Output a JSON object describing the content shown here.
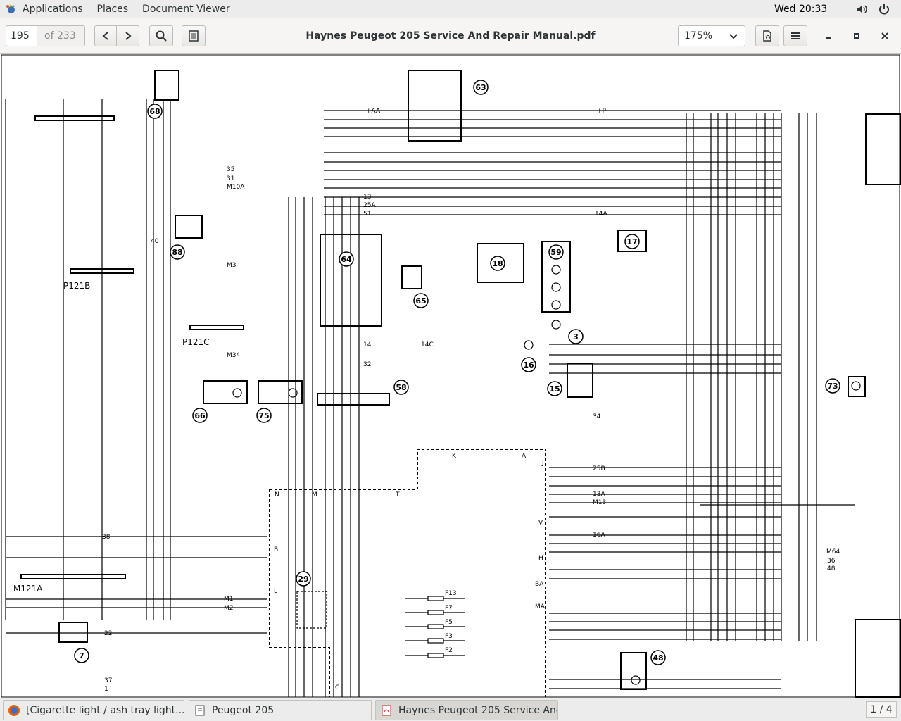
{
  "topbar": {
    "applications": "Applications",
    "places": "Places",
    "app_name": "Document Viewer",
    "clock": "Wed 20:33"
  },
  "toolbar": {
    "page_current": "195",
    "page_total": "of 233",
    "title": "Haynes Peugeot 205 Service And Repair Manual.pdf",
    "zoom": "175%"
  },
  "diagram": {
    "components": [
      "68",
      "63",
      "88",
      "64",
      "65",
      "18",
      "59",
      "17",
      "3",
      "16",
      "15",
      "73",
      "66",
      "75",
      "58",
      "29",
      "7",
      "48"
    ],
    "sockets": [
      "P121B",
      "P121C",
      "M121A"
    ],
    "wire_labels": [
      "+AA",
      "+P",
      "35",
      "31",
      "M10A",
      "13",
      "25A",
      "51",
      "14A",
      "M3",
      "14",
      "M34",
      "32",
      "14C",
      "25B",
      "13A",
      "M13",
      "16A",
      "34",
      "38",
      "M1",
      "M2",
      "22",
      "37",
      "1",
      "36",
      "48",
      "M64",
      "F13",
      "F7",
      "F5",
      "F3",
      "F2",
      "N",
      "M",
      "T",
      "K",
      "A",
      "B",
      "L",
      "H",
      "BA",
      "MA",
      "C",
      "V",
      "J",
      "40"
    ]
  },
  "taskbar": {
    "items": [
      {
        "label": "[Cigarette light / ash tray light... - Bo..."
      },
      {
        "label": "Peugeot 205"
      },
      {
        "label": "Haynes Peugeot 205 Service And R..."
      }
    ],
    "pager": "1 / 4"
  },
  "colors": {
    "topbar": "#ececec",
    "headerbar": "#f6f5f4",
    "wire": "#000000"
  }
}
